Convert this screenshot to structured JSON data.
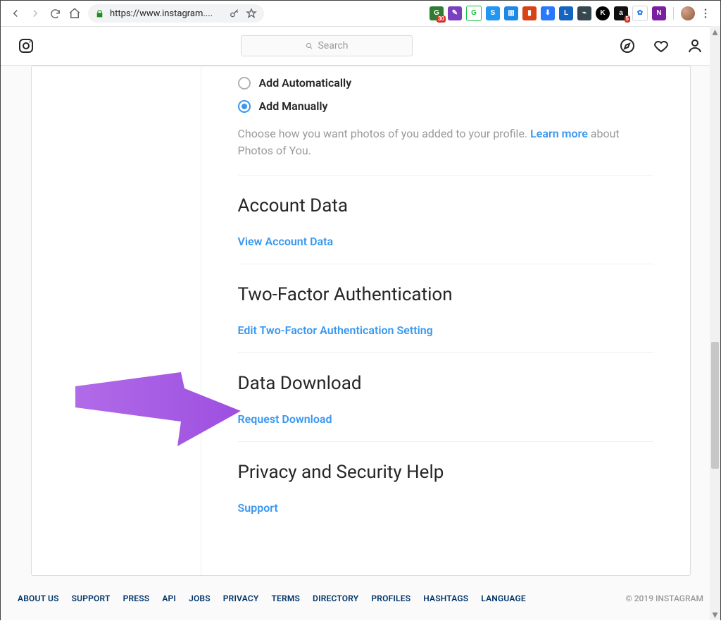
{
  "chrome": {
    "url": "https://www.instagram....",
    "extension_badges": {
      "red1": "30",
      "red2": "5"
    }
  },
  "nav": {
    "search_placeholder": "Search"
  },
  "tagging": {
    "option_auto": "Add Automatically",
    "option_manual": "Add Manually",
    "desc_before": "Choose how you want photos of you added to your profile. ",
    "learn_more": "Learn more",
    "desc_after": " about Photos of You."
  },
  "sections": {
    "account_data": {
      "title": "Account Data",
      "link": "View Account Data"
    },
    "two_factor": {
      "title": "Two-Factor Authentication",
      "link": "Edit Two-Factor Authentication Setting"
    },
    "data_download": {
      "title": "Data Download",
      "link": "Request Download"
    },
    "help": {
      "title": "Privacy and Security Help",
      "link": "Support"
    }
  },
  "footer": {
    "links": [
      "ABOUT US",
      "SUPPORT",
      "PRESS",
      "API",
      "JOBS",
      "PRIVACY",
      "TERMS",
      "DIRECTORY",
      "PROFILES",
      "HASHTAGS",
      "LANGUAGE"
    ],
    "copyright": "© 2019 INSTAGRAM"
  }
}
